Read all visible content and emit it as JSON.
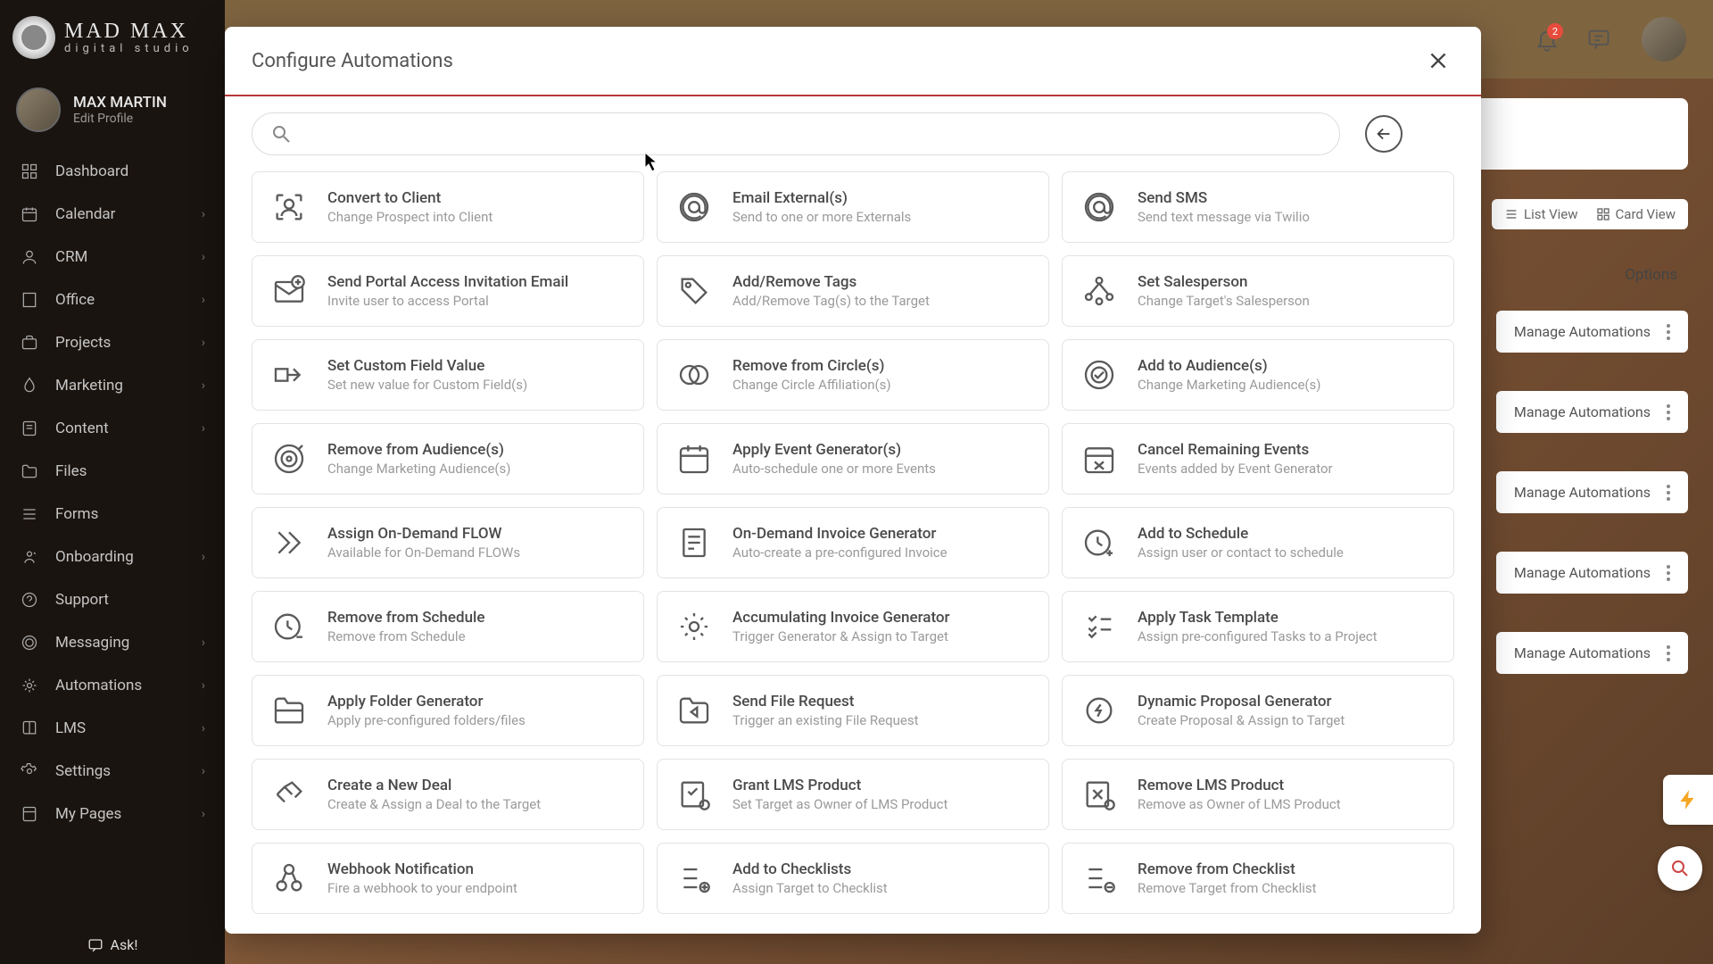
{
  "brand": {
    "name": "MAD MAX",
    "sub": "digital studio"
  },
  "profile": {
    "name": "MAX MARTIN",
    "edit": "Edit Profile"
  },
  "nav": [
    {
      "label": "Dashboard",
      "chevron": false
    },
    {
      "label": "Calendar",
      "chevron": true
    },
    {
      "label": "CRM",
      "chevron": true
    },
    {
      "label": "Office",
      "chevron": true
    },
    {
      "label": "Projects",
      "chevron": true
    },
    {
      "label": "Marketing",
      "chevron": true
    },
    {
      "label": "Content",
      "chevron": true
    },
    {
      "label": "Files",
      "chevron": false
    },
    {
      "label": "Forms",
      "chevron": false
    },
    {
      "label": "Onboarding",
      "chevron": true
    },
    {
      "label": "Support",
      "chevron": false
    },
    {
      "label": "Messaging",
      "chevron": true
    },
    {
      "label": "Automations",
      "chevron": true
    },
    {
      "label": "LMS",
      "chevron": true
    },
    {
      "label": "Settings",
      "chevron": true
    },
    {
      "label": "My Pages",
      "chevron": true
    }
  ],
  "ask": "Ask!",
  "notifications_badge": "2",
  "modal": {
    "title": "Configure Automations",
    "search_placeholder": ""
  },
  "views": {
    "list": "List View",
    "card": "Card View"
  },
  "options_label": "Options",
  "manage_label": "Manage Automations",
  "cards": [
    {
      "title": "Convert to Client",
      "sub": "Change Prospect into Client",
      "icon": "user-focus"
    },
    {
      "title": "Email External(s)",
      "sub": "Send to one or more Externals",
      "icon": "at"
    },
    {
      "title": "Send SMS",
      "sub": "Send text message via Twilio",
      "icon": "at"
    },
    {
      "title": "Send Portal Access Invitation Email",
      "sub": "Invite user to access Portal",
      "icon": "mail-plus"
    },
    {
      "title": "Add/Remove Tags",
      "sub": "Add/Remove Tag(s) to the Target",
      "icon": "tag"
    },
    {
      "title": "Set Salesperson",
      "sub": "Change Target's Salesperson",
      "icon": "network"
    },
    {
      "title": "Set Custom Field Value",
      "sub": "Set new value for Custom Field(s)",
      "icon": "field"
    },
    {
      "title": "Remove from Circle(s)",
      "sub": "Change Circle Affiliation(s)",
      "icon": "circles"
    },
    {
      "title": "Add to Audience(s)",
      "sub": "Change Marketing Audience(s)",
      "icon": "target-check"
    },
    {
      "title": "Remove from Audience(s)",
      "sub": "Change Marketing Audience(s)",
      "icon": "target-swirl"
    },
    {
      "title": "Apply Event Generator(s)",
      "sub": "Auto-schedule one or more Events",
      "icon": "calendar"
    },
    {
      "title": "Cancel Remaining Events",
      "sub": "Events added by Event Generator",
      "icon": "calendar-x"
    },
    {
      "title": "Assign On-Demand FLOW",
      "sub": "Available for On-Demand FLOWs",
      "icon": "chevrons"
    },
    {
      "title": "On-Demand Invoice Generator",
      "sub": "Auto-create a pre-configured Invoice",
      "icon": "invoice"
    },
    {
      "title": "Add to Schedule",
      "sub": "Assign user or contact to schedule",
      "icon": "clock-plus"
    },
    {
      "title": "Remove from Schedule",
      "sub": "Remove from Schedule",
      "icon": "clock-minus"
    },
    {
      "title": "Accumulating Invoice Generator",
      "sub": "Trigger Generator & Assign to Target",
      "icon": "gear"
    },
    {
      "title": "Apply Task Template",
      "sub": "Assign pre-configured Tasks to a Project",
      "icon": "checklist"
    },
    {
      "title": "Apply Folder Generator",
      "sub": "Apply pre-configured folders/files",
      "icon": "folder-gen"
    },
    {
      "title": "Send File Request",
      "sub": "Trigger an existing File Request",
      "icon": "folder-send"
    },
    {
      "title": "Dynamic Proposal Generator",
      "sub": "Create Proposal & Assign to Target",
      "icon": "gear-bolt"
    },
    {
      "title": "Create a New Deal",
      "sub": "Create & Assign a Deal to the Target",
      "icon": "handshake"
    },
    {
      "title": "Grant LMS Product",
      "sub": "Set Target as Owner of LMS Product",
      "icon": "lms-check"
    },
    {
      "title": "Remove LMS Product",
      "sub": "Remove as Owner of LMS Product",
      "icon": "lms-x"
    },
    {
      "title": "Webhook Notification",
      "sub": "Fire a webhook to your endpoint",
      "icon": "webhook"
    },
    {
      "title": "Add to Checklists",
      "sub": "Assign Target to Checklist",
      "icon": "checklist-add"
    },
    {
      "title": "Remove from Checklist",
      "sub": "Remove Target from Checklist",
      "icon": "checklist-remove"
    }
  ]
}
